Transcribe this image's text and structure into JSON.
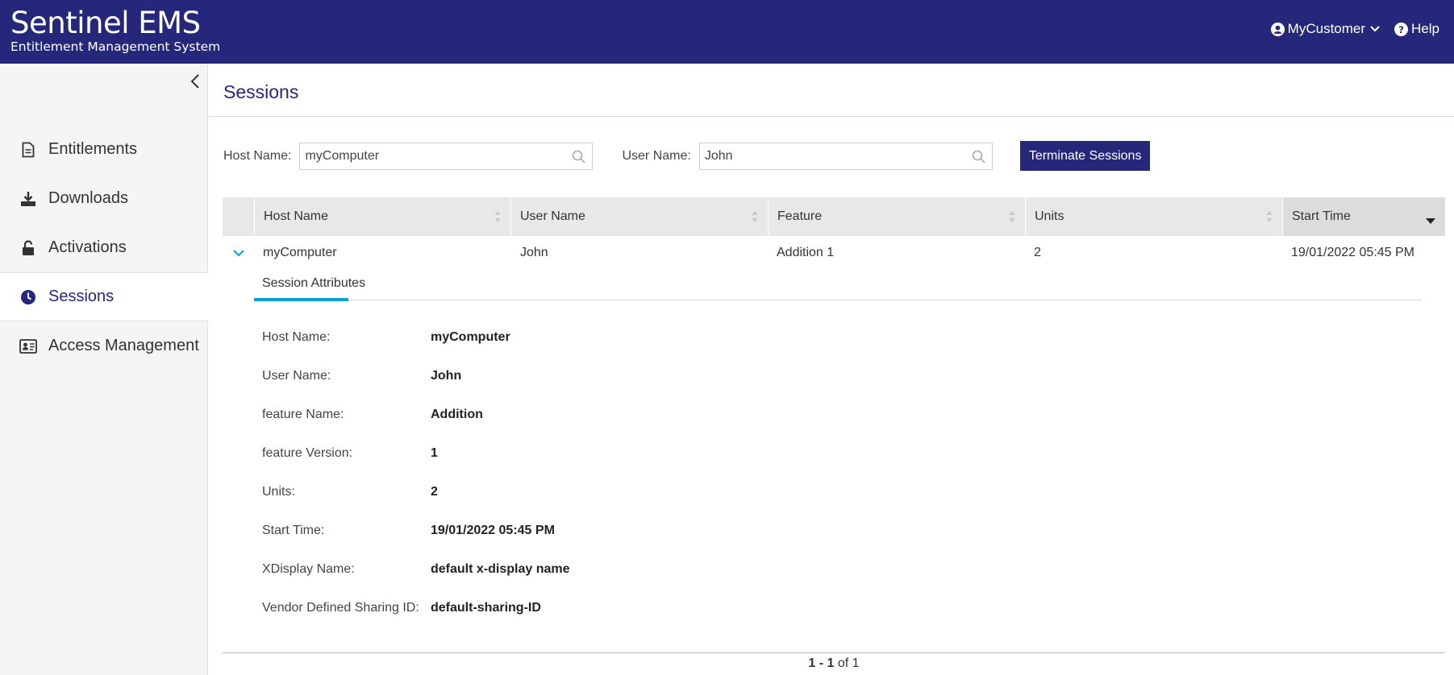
{
  "header": {
    "brand_title": "Sentinel EMS",
    "brand_subtitle": "Entitlement Management System",
    "user_label": "MyCustomer",
    "help_label": "Help",
    "bg_color": "#25287a"
  },
  "sidebar": {
    "items": [
      {
        "label": "Entitlements",
        "icon": "document-icon",
        "active": false
      },
      {
        "label": "Downloads",
        "icon": "download-icon",
        "active": false
      },
      {
        "label": "Activations",
        "icon": "unlock-icon",
        "active": false
      },
      {
        "label": "Sessions",
        "icon": "clock-icon",
        "active": true
      },
      {
        "label": "Access Management",
        "icon": "id-card-icon",
        "active": false
      }
    ]
  },
  "main": {
    "title": "Sessions",
    "filters": {
      "host_label": "Host Name:",
      "host_value": "myComputer",
      "user_label": "User Name:",
      "user_value": "John",
      "terminate_label": "Terminate Sessions"
    },
    "table": {
      "columns": [
        "Host Name",
        "User Name",
        "Feature",
        "Units",
        "Start Time"
      ],
      "rows": [
        {
          "host": "myComputer",
          "user": "John",
          "feature": "Addition 1",
          "units": "2",
          "start": "19/01/2022 05:45 PM"
        }
      ]
    },
    "detail": {
      "tab_label": "Session Attributes",
      "attributes": [
        {
          "key": "Host Name:",
          "value": "myComputer"
        },
        {
          "key": "User Name:",
          "value": "John"
        },
        {
          "key": "feature Name:",
          "value": "Addition"
        },
        {
          "key": "feature Version:",
          "value": "1"
        },
        {
          "key": "Units:",
          "value": "2"
        },
        {
          "key": "Start Time:",
          "value": "19/01/2022 05:45 PM"
        },
        {
          "key": "XDisplay Name:",
          "value": "default x-display name"
        },
        {
          "key": "Vendor Defined Sharing ID:",
          "value": "default-sharing-ID"
        }
      ]
    },
    "pager": {
      "range": "1 - 1",
      "of_text": "of 1"
    }
  },
  "colors": {
    "accent": "#25287a",
    "tab_indicator": "#00a3d9"
  }
}
